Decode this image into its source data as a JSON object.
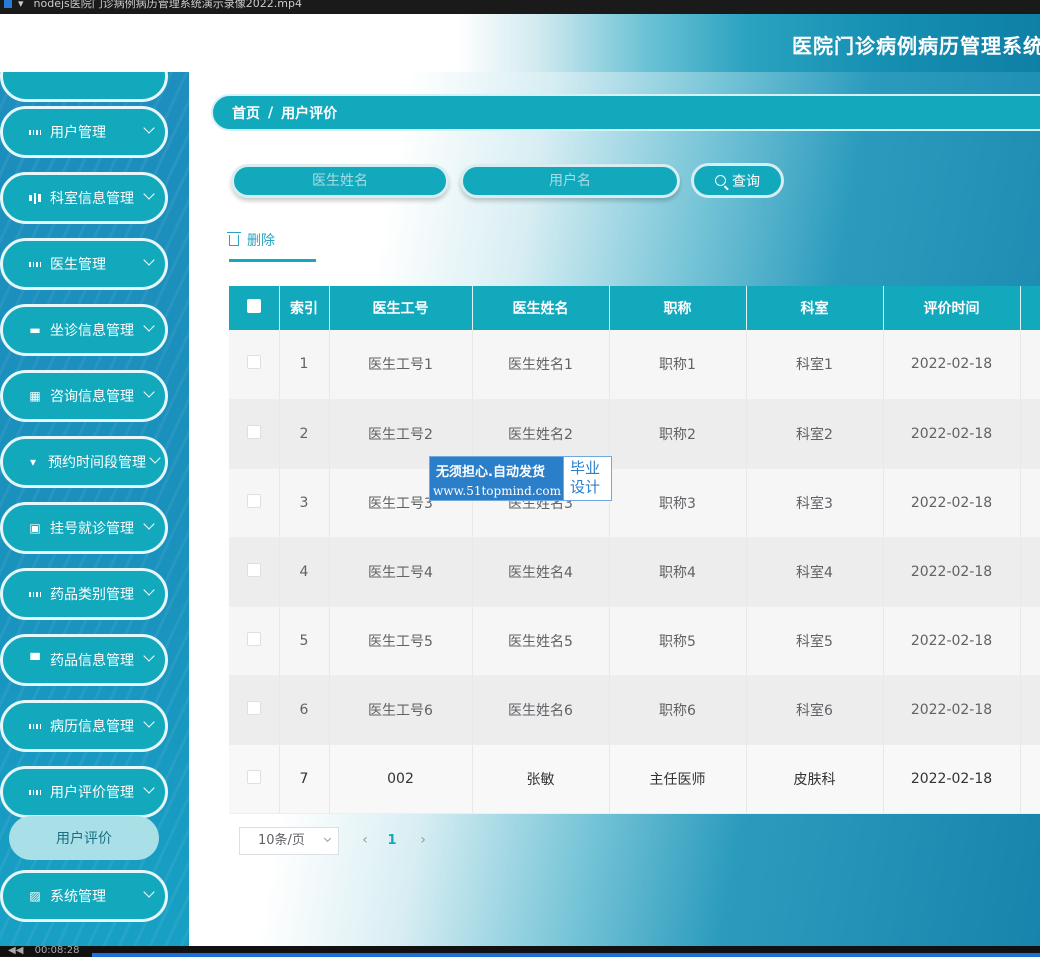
{
  "window": {
    "title": "nodejs医院门诊病例病历管理系统演示录像2022.mp4"
  },
  "header": {
    "system_title": "医院门诊病例病历管理系统"
  },
  "sidebar": {
    "items": [
      {
        "label": "用户管理",
        "icon": "grid-icon"
      },
      {
        "label": "科室信息管理",
        "icon": "bar-chart-icon"
      },
      {
        "label": "医生管理",
        "icon": "grid-icon"
      },
      {
        "label": "坐诊信息管理",
        "icon": "ticket-icon"
      },
      {
        "label": "咨询信息管理",
        "icon": "table-icon"
      },
      {
        "label": "预约时间段管理",
        "icon": "stamp-icon"
      },
      {
        "label": "挂号就诊管理",
        "icon": "clipboard-icon"
      },
      {
        "label": "药品类别管理",
        "icon": "grid-icon"
      },
      {
        "label": "药品信息管理",
        "icon": "briefcase-icon"
      },
      {
        "label": "病历信息管理",
        "icon": "grid-icon"
      },
      {
        "label": "用户评价管理",
        "icon": "grid-icon"
      },
      {
        "label": "系统管理",
        "icon": "picture-icon"
      }
    ],
    "active_sub_item": "用户评价"
  },
  "breadcrumb": {
    "home": "首页",
    "separator": "/",
    "current": "用户评价"
  },
  "search": {
    "doctor_name_placeholder": "医生姓名",
    "username_placeholder": "用户名",
    "button_label": "查询"
  },
  "toolbar": {
    "delete_label": "删除"
  },
  "table": {
    "columns": [
      "索引",
      "医生工号",
      "医生姓名",
      "职称",
      "科室",
      "评价时间"
    ],
    "rows": [
      {
        "index": "1",
        "doctor_id": "医生工号1",
        "doctor_name": "医生姓名1",
        "title": "职称1",
        "department": "科室1",
        "eval_time": "2022-02-18"
      },
      {
        "index": "2",
        "doctor_id": "医生工号2",
        "doctor_name": "医生姓名2",
        "title": "职称2",
        "department": "科室2",
        "eval_time": "2022-02-18"
      },
      {
        "index": "3",
        "doctor_id": "医生工号3",
        "doctor_name": "医生姓名3",
        "title": "职称3",
        "department": "科室3",
        "eval_time": "2022-02-18"
      },
      {
        "index": "4",
        "doctor_id": "医生工号4",
        "doctor_name": "医生姓名4",
        "title": "职称4",
        "department": "科室4",
        "eval_time": "2022-02-18"
      },
      {
        "index": "5",
        "doctor_id": "医生工号5",
        "doctor_name": "医生姓名5",
        "title": "职称5",
        "department": "科室5",
        "eval_time": "2022-02-18"
      },
      {
        "index": "6",
        "doctor_id": "医生工号6",
        "doctor_name": "医生姓名6",
        "title": "职称6",
        "department": "科室6",
        "eval_time": "2022-02-18"
      },
      {
        "index": "7",
        "doctor_id": "002",
        "doctor_name": "张敏",
        "title": "主任医师",
        "department": "皮肤科",
        "eval_time": "2022-02-18"
      }
    ]
  },
  "pagination": {
    "page_size": "10条/页",
    "current_page": "1"
  },
  "watermark": {
    "line1": "无须担心.自动发货",
    "line2": "www.51topmind.com",
    "badge": "毕业设计"
  },
  "player": {
    "time": "00:08:28"
  },
  "colors": {
    "primary": "#12a9bd",
    "sidebar": "#1a90bd",
    "header_accent": "#0f7fa6"
  }
}
